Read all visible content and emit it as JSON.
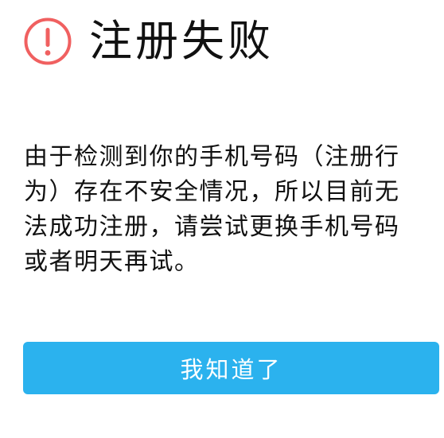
{
  "dialog": {
    "icon": "exclamation-circle-icon",
    "icon_color": "#f06060",
    "title": "注册失败",
    "message": "由于检测到你的手机号码（注册行为）存在不安全情况，所以目前无法成功注册，请尝试更换手机号码或者明天再试。",
    "confirm_label": "我知道了",
    "accent_color": "#2bb2ee"
  }
}
